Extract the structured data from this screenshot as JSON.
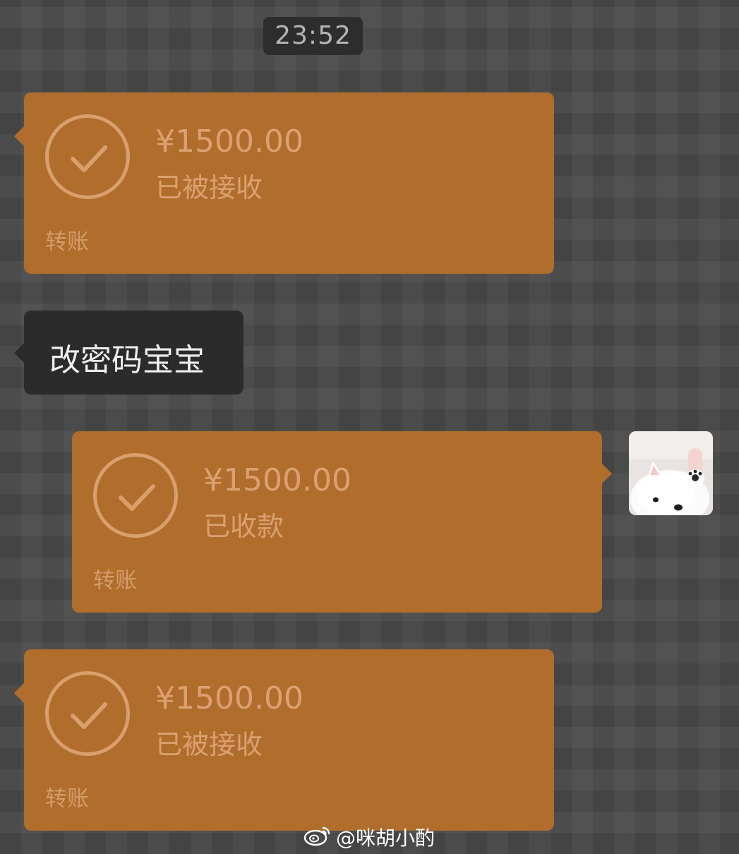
{
  "timestamp": "23:52",
  "messages": [
    {
      "type": "transfer",
      "side": "left",
      "amount": "¥1500.00",
      "status": "已被接收",
      "label": "转账"
    },
    {
      "type": "text",
      "side": "left",
      "text": "改密码宝宝"
    },
    {
      "type": "transfer",
      "side": "right",
      "amount": "¥1500.00",
      "status": "已收款",
      "label": "转账"
    },
    {
      "type": "transfer",
      "side": "left",
      "amount": "¥1500.00",
      "status": "已被接收",
      "label": "转账"
    }
  ],
  "watermark": {
    "text": "@咪胡小酌",
    "icon": "weibo-icon"
  },
  "colors": {
    "transfer_bubble": "#b06d2b",
    "transfer_text": "#dba172",
    "text_bubble": "#2b2b2b",
    "background": "#4c4c4c"
  }
}
